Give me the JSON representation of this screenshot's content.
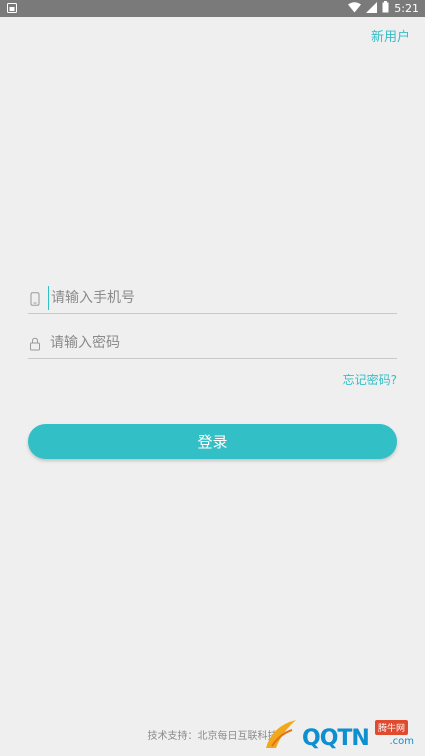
{
  "status_bar": {
    "time": "5:21"
  },
  "header": {
    "new_user_label": "新用户"
  },
  "form": {
    "phone": {
      "placeholder": "请输入手机号",
      "value": ""
    },
    "password": {
      "placeholder": "请输入密码",
      "value": ""
    },
    "forgot_label": "忘记密码?",
    "login_label": "登录"
  },
  "footer": {
    "text": "技术支持：北京每日互联科技"
  },
  "watermark": {
    "badge": "腾牛网",
    "brand": "QQTN",
    "suffix": ".com"
  },
  "colors": {
    "accent": "#33bfc6",
    "background": "#efefef"
  },
  "icons": {
    "phone": "phone-icon",
    "lock": "lock-icon"
  }
}
